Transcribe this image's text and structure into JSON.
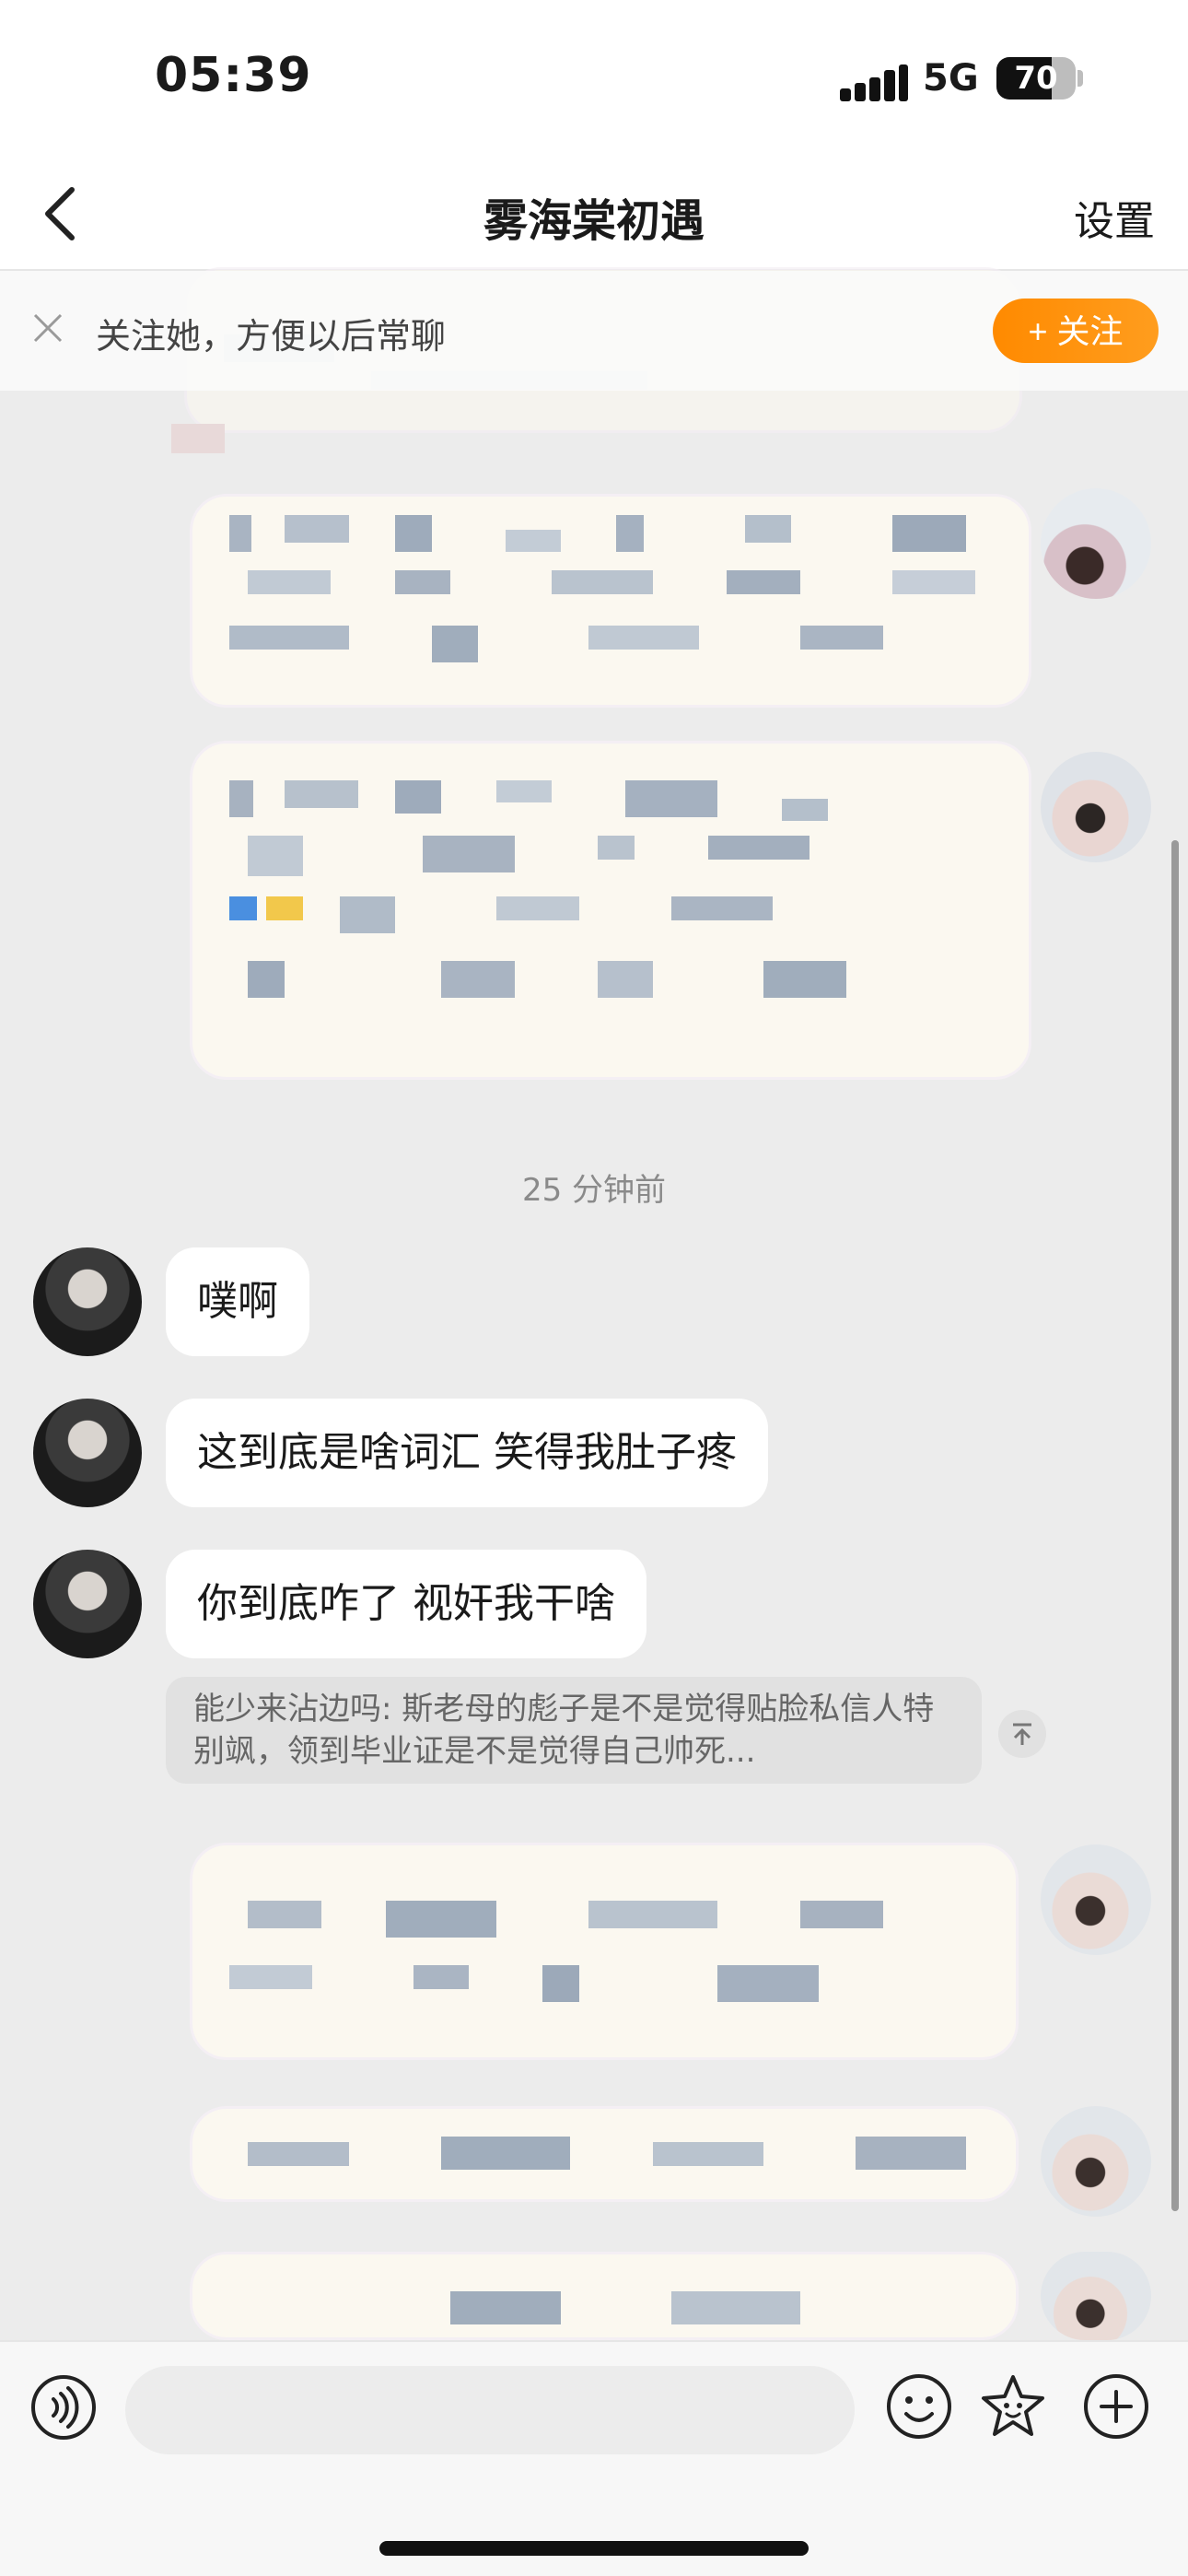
{
  "status_bar": {
    "time": "05:39",
    "network": "5G",
    "battery": "70",
    "battery_fraction": 0.7
  },
  "nav": {
    "title": "雾海棠初遇",
    "settings_label": "设置",
    "back_icon": "chevron-left-icon"
  },
  "follow_banner": {
    "text": "关注她，方便以后常聊",
    "button_label": "+ 关注",
    "accent": "#ff8a00"
  },
  "timestamp": "25 分钟前",
  "messages": [
    {
      "text": "噗啊"
    },
    {
      "text": "这到底是啥词汇 笑得我肚子疼"
    },
    {
      "text": "你到底咋了 视奸我干啥"
    }
  ],
  "quote": {
    "text": "能少来沾边吗: 斯老母的彪子是不是觉得贴脸私信人特别飒，领到毕业证是不是觉得自己帅死..."
  },
  "input": {
    "placeholder": ""
  },
  "toolbar": {
    "voice_icon": "voice-icon",
    "emoji_icon": "emoji-icon",
    "sticker_icon": "sticker-icon",
    "add_icon": "add-icon"
  },
  "colors": {
    "background": "#ececec",
    "bubble": "#ffffff",
    "quote_bg": "#e1e1e1",
    "blur_bubble": "#fbf8f0"
  }
}
